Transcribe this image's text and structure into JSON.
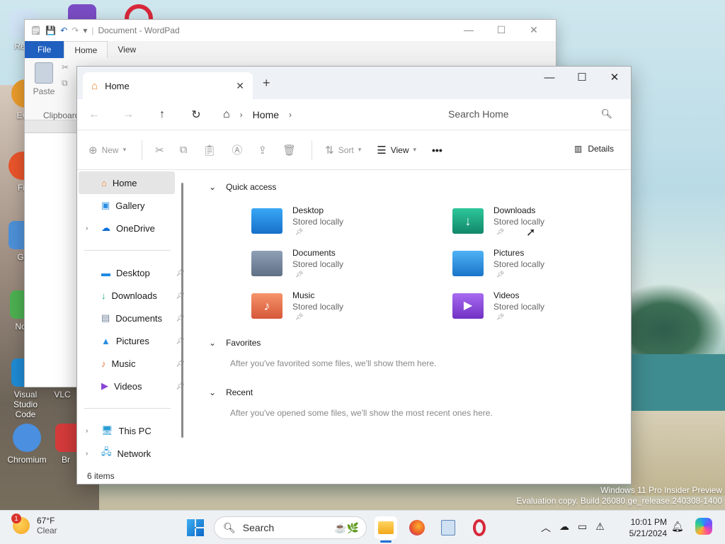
{
  "desktop": {
    "icons": [
      {
        "label": "Recy",
        "color": "#5aa3e0"
      },
      {
        "label": "Ever",
        "color": "#e89a2b"
      },
      {
        "label": "Fir",
        "color": "#e8542b"
      },
      {
        "label": "Git",
        "color": "#4d8fd6"
      },
      {
        "label": "Note",
        "color": "#4caf50"
      },
      {
        "label": "Visual Studio Code",
        "color": "#1f8ad2"
      },
      {
        "label": "VLC",
        "color": "#f07d00"
      },
      {
        "label": "Chromium",
        "color": "#4a8fe0"
      },
      {
        "label": "Br",
        "color": "#d63b3b"
      }
    ]
  },
  "wordpad": {
    "title": "Document - WordPad",
    "tabs": [
      "File",
      "Home",
      "View"
    ],
    "paste_label": "Paste",
    "clipboard_label": "Clipboard",
    "help_label": "?"
  },
  "explorer": {
    "tab_title": "Home",
    "breadcrumb": "Home",
    "search_placeholder": "Search Home",
    "commands": {
      "new": "New",
      "sort": "Sort",
      "view": "View",
      "more": "•••",
      "details": "Details"
    },
    "nav": {
      "top": [
        {
          "label": "Home",
          "icon": "home-icon",
          "selected": true
        },
        {
          "label": "Gallery",
          "icon": "gallery-icon"
        },
        {
          "label": "OneDrive",
          "icon": "onedrive-icon",
          "expandable": true
        }
      ],
      "pinned": [
        {
          "label": "Desktop",
          "icon": "desktop-icon"
        },
        {
          "label": "Downloads",
          "icon": "downloads-icon"
        },
        {
          "label": "Documents",
          "icon": "documents-icon"
        },
        {
          "label": "Pictures",
          "icon": "pictures-icon"
        },
        {
          "label": "Music",
          "icon": "music-icon"
        },
        {
          "label": "Videos",
          "icon": "videos-icon"
        }
      ],
      "bottom": [
        {
          "label": "This PC",
          "icon": "this-pc-icon"
        },
        {
          "label": "Network",
          "icon": "network-icon"
        }
      ]
    },
    "sections": {
      "quick_access": "Quick access",
      "favorites": "Favorites",
      "favorites_empty": "After you've favorited some files, we'll show them here.",
      "recent": "Recent",
      "recent_empty": "After you've opened some files, we'll show the most recent ones here."
    },
    "quick_access_items": [
      {
        "name": "Desktop",
        "sub": "Stored locally",
        "color": "#1e88e5"
      },
      {
        "name": "Downloads",
        "sub": "Stored locally",
        "color": "#1aa37a"
      },
      {
        "name": "Documents",
        "sub": "Stored locally",
        "color": "#6f7f95"
      },
      {
        "name": "Pictures",
        "sub": "Stored locally",
        "color": "#2b8fe0"
      },
      {
        "name": "Music",
        "sub": "Stored locally",
        "color": "#e8733a"
      },
      {
        "name": "Videos",
        "sub": "Stored locally",
        "color": "#8a45d6"
      }
    ],
    "status": "6 items"
  },
  "watermark": {
    "line1": "Windows 11 Pro Insider Preview",
    "line2": "Evaluation copy. Build 26080.ge_release.240308-1400"
  },
  "taskbar": {
    "weather_temp": "67°F",
    "weather_desc": "Clear",
    "weather_badge": "1",
    "search_label": "Search",
    "time": "10:01 PM",
    "date": "5/21/2024",
    "accent": "#1f6fd6"
  }
}
